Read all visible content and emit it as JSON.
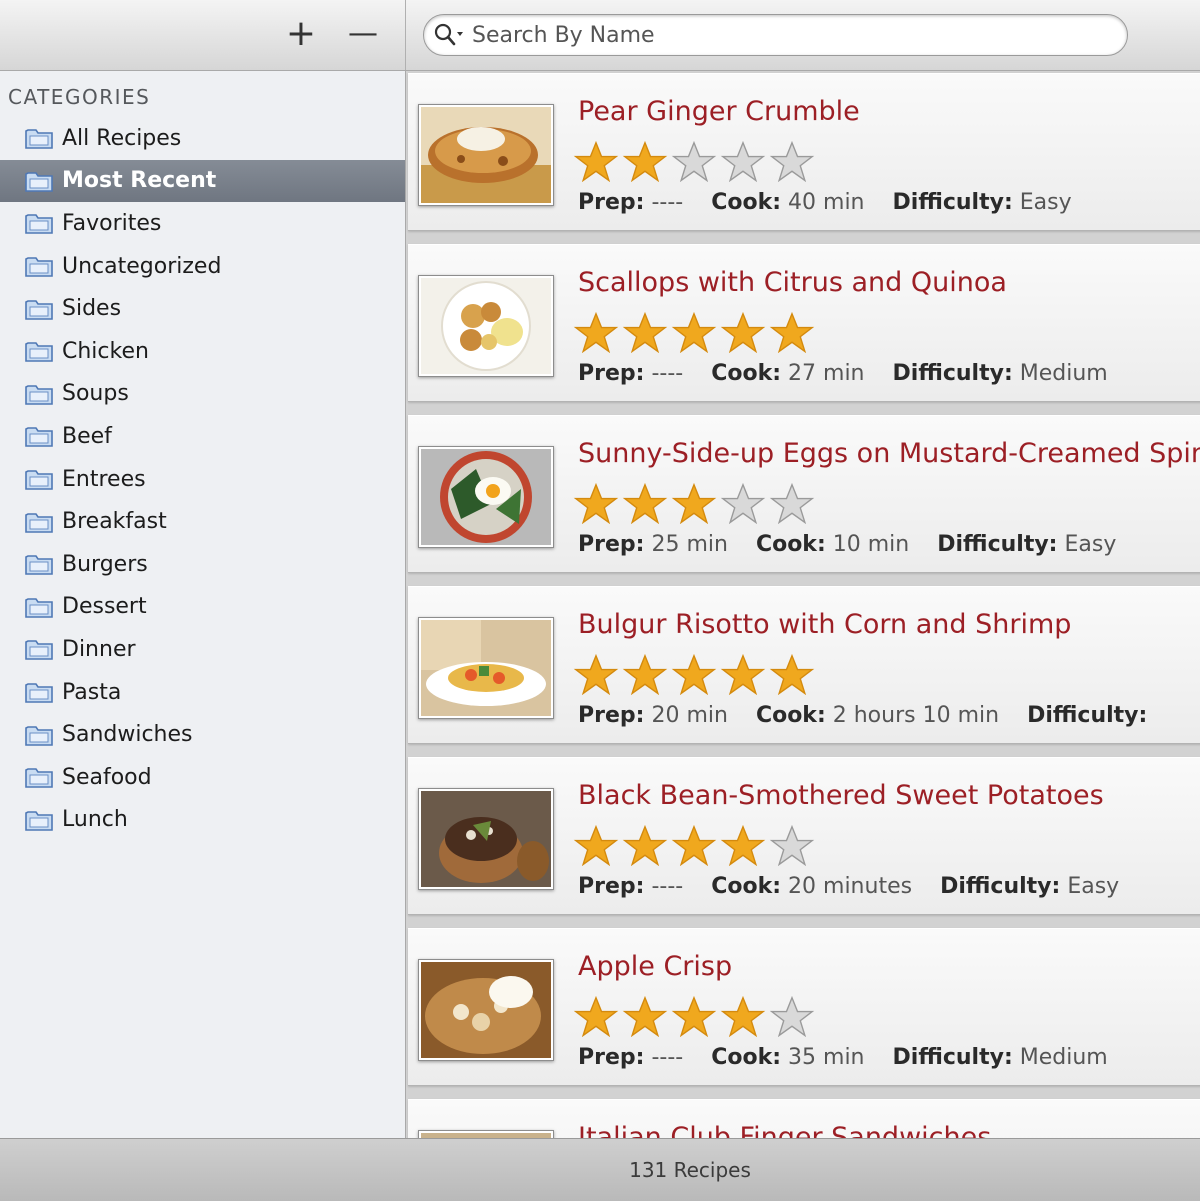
{
  "toolbar": {
    "add_label": "+",
    "remove_label": "—",
    "search": {
      "placeholder": "Search By Name",
      "value": ""
    }
  },
  "sidebar": {
    "heading": "CATEGORIES",
    "selected": "Most Recent",
    "items": [
      {
        "label": "All Recipes"
      },
      {
        "label": "Most Recent"
      },
      {
        "label": "Favorites"
      },
      {
        "label": "Uncategorized"
      },
      {
        "label": "Sides"
      },
      {
        "label": "Chicken"
      },
      {
        "label": "Soups"
      },
      {
        "label": "Beef"
      },
      {
        "label": "Entrees"
      },
      {
        "label": "Breakfast"
      },
      {
        "label": "Burgers"
      },
      {
        "label": "Dessert"
      },
      {
        "label": "Dinner"
      },
      {
        "label": "Pasta"
      },
      {
        "label": "Sandwiches"
      },
      {
        "label": "Seafood"
      },
      {
        "label": "Lunch"
      }
    ]
  },
  "labels": {
    "prep": "Prep:",
    "cook": "Cook:",
    "difficulty": "Difficulty:"
  },
  "recipes": [
    {
      "title": "Pear Ginger Crumble",
      "rating": 2,
      "prep": "----",
      "cook": "40 min",
      "difficulty": "Easy",
      "thumb": "crumble"
    },
    {
      "title": "Scallops with Citrus and Quinoa",
      "rating": 5,
      "prep": "----",
      "cook": "27 min",
      "difficulty": "Medium",
      "thumb": "scallops"
    },
    {
      "title": "Sunny-Side-up Eggs on Mustard-Creamed Spinc",
      "rating": 3,
      "prep": "25 min",
      "cook": "10 min",
      "difficulty": "Easy",
      "thumb": "eggs"
    },
    {
      "title": "Bulgur Risotto with Corn and Shrimp",
      "rating": 5,
      "prep": "20 min",
      "cook": "2 hours 10 min",
      "difficulty": "",
      "thumb": "risotto"
    },
    {
      "title": "Black Bean-Smothered Sweet Potatoes",
      "rating": 4,
      "prep": "----",
      "cook": "20 minutes",
      "difficulty": "Easy",
      "thumb": "potatoes"
    },
    {
      "title": "Apple Crisp",
      "rating": 4,
      "prep": "----",
      "cook": "35 min",
      "difficulty": "Medium",
      "thumb": "crisp"
    },
    {
      "title": "Italian Club Finger Sandwiches",
      "rating": 0,
      "prep": "",
      "cook": "",
      "difficulty": "",
      "thumb": "sandwich"
    }
  ],
  "status": {
    "text": "131 Recipes"
  },
  "colors": {
    "title": "#9c1f25",
    "star_on": "#f0a81e",
    "star_off": "#d9d9d9",
    "selection": "#7a818b"
  },
  "icons": {
    "add": "plus-icon",
    "remove": "minus-icon",
    "search": "search-icon",
    "category": "folder-icon",
    "rating": "star-icon"
  }
}
